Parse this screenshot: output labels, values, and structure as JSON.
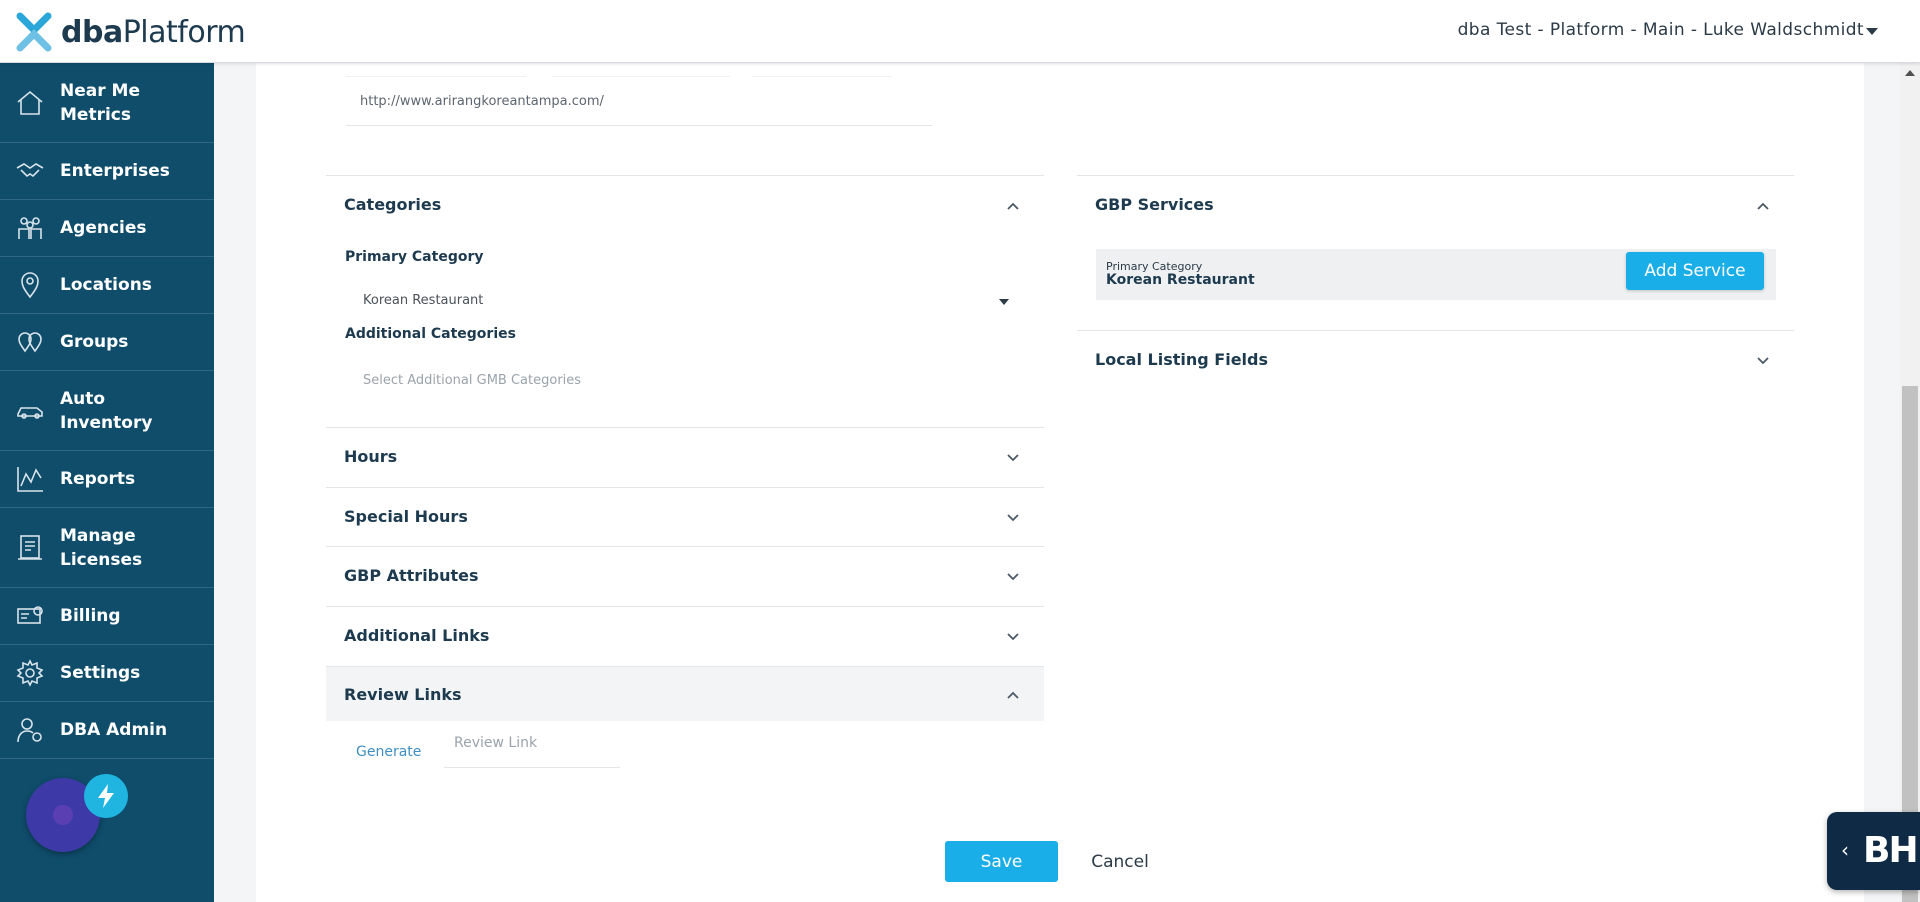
{
  "header": {
    "brand_bold": "dba",
    "brand_light": "Platform",
    "account": "dba Test - Platform - Main - Luke Waldschmidt"
  },
  "sidebar": {
    "items": [
      {
        "label": "Near Me Metrics",
        "icon": "home-icon"
      },
      {
        "label": "Enterprises",
        "icon": "handshake-icon"
      },
      {
        "label": "Agencies",
        "icon": "people-icon"
      },
      {
        "label": "Locations",
        "icon": "map-pin-icon"
      },
      {
        "label": "Groups",
        "icon": "group-pins-icon"
      },
      {
        "label": "Auto Inventory",
        "icon": "car-icon"
      },
      {
        "label": "Reports",
        "icon": "chart-icon"
      },
      {
        "label": "Manage Licenses",
        "icon": "license-icon"
      },
      {
        "label": "Billing",
        "icon": "billing-icon"
      },
      {
        "label": "Settings",
        "icon": "gear-icon"
      },
      {
        "label": "DBA Admin",
        "icon": "admin-icon"
      }
    ]
  },
  "website": {
    "url": "http://www.arirangkoreantampa.com/"
  },
  "categories": {
    "title": "Categories",
    "primary_label": "Primary Category",
    "primary_value": "Korean Restaurant",
    "additional_label": "Additional Categories",
    "additional_placeholder": "Select Additional GMB Categories"
  },
  "panels": {
    "hours": "Hours",
    "special_hours": "Special Hours",
    "gbp_attributes": "GBP Attributes",
    "additional_links": "Additional Links",
    "review_links": "Review Links"
  },
  "review_links": {
    "generate": "Generate",
    "placeholder": "Review Link"
  },
  "gbp_services": {
    "title": "GBP Services",
    "primary_label": "Primary Category",
    "primary_value": "Korean Restaurant",
    "add_button": "Add Service"
  },
  "local_listing": {
    "title": "Local Listing Fields"
  },
  "actions": {
    "save": "Save",
    "cancel": "Cancel"
  },
  "widget": {
    "text": "BH.",
    "arrow": "‹"
  },
  "colors": {
    "sidebar": "#0f4d6b",
    "accent": "#1aaee9",
    "link": "#3f8fc0",
    "text": "#1d3a4f"
  }
}
